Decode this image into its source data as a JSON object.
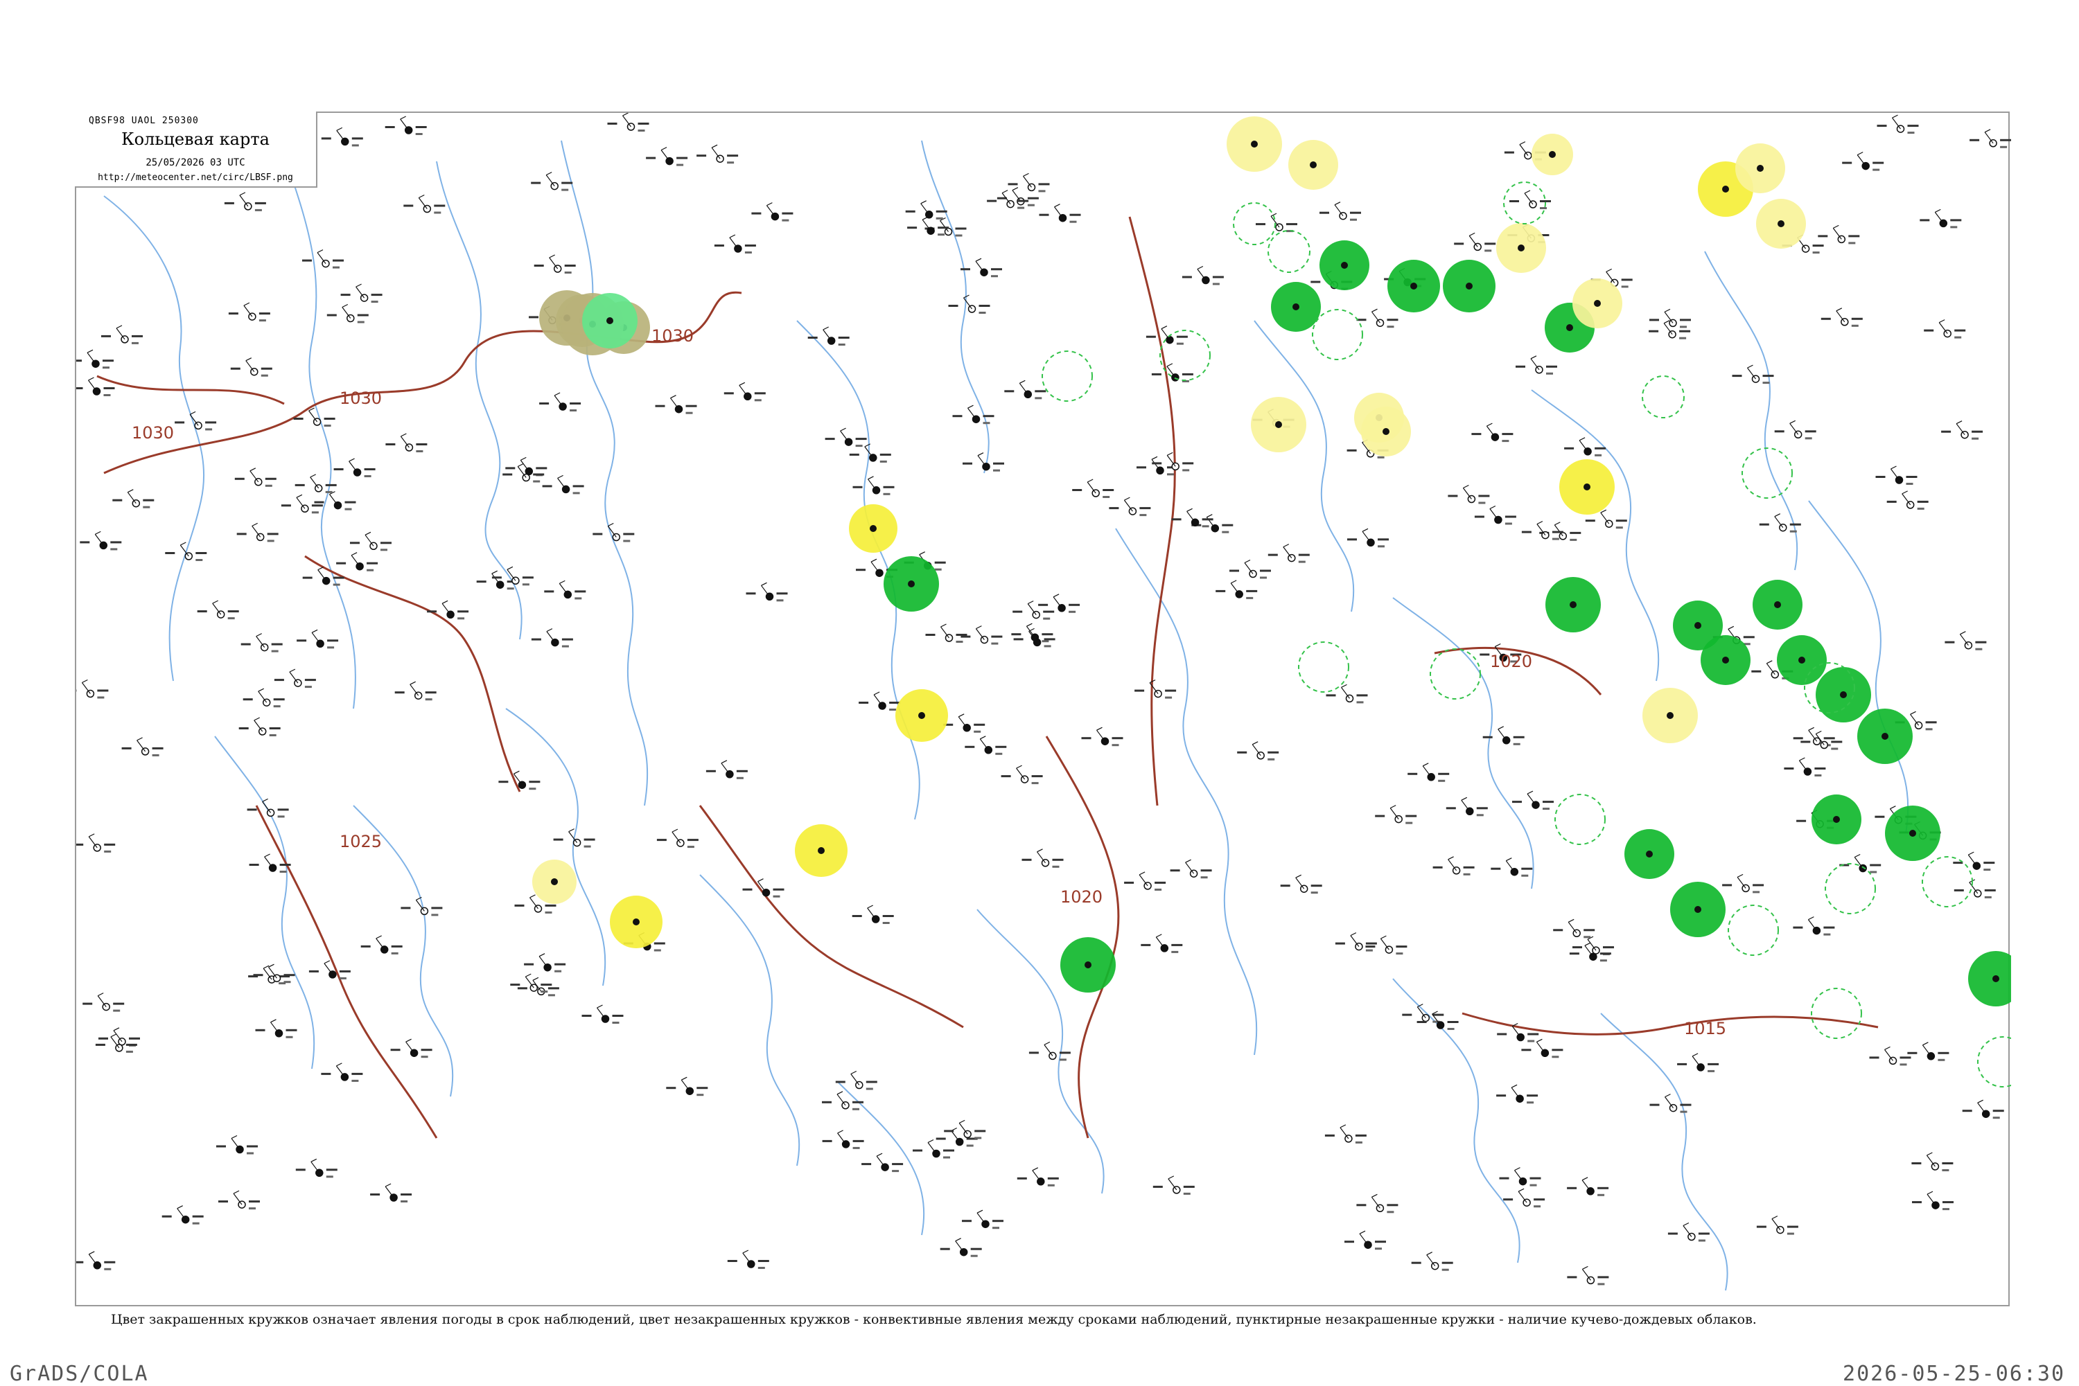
{
  "header": {
    "code": "QBSF98  UAOL  250300",
    "title": "Кольцевая карта",
    "datetime": "25/05/2026 03 UTC",
    "url": "http://meteocenter.net/circ/LBSF.png"
  },
  "isobars": [
    {
      "label": "1030"
    },
    {
      "label": "1030"
    },
    {
      "label": "1030"
    },
    {
      "label": "1025"
    },
    {
      "label": "1020"
    },
    {
      "label": "1015"
    },
    {
      "label": "1020"
    }
  ],
  "colors": {
    "isobar": "#9a3b2a",
    "river": "#7fb2e6",
    "dashed_circle": "#34c24a",
    "yellow_fill": "#f5ef3a",
    "yellow_light": "#f8f39a",
    "green_fill": "#11b82e",
    "light_green": "#63e58b",
    "olive_fill": "#b9b27a",
    "frame": "#9a9a9a"
  },
  "legend_note": "Цвет закрашенных кружков означает явления погоды в срок наблюдений, цвет незакрашенных кружков - конвективные явления между сроками наблюдений, пунктирные незакрашенные кружки - наличие кучево-дождевых облаков.",
  "footer": {
    "left": "GrADS/COLA",
    "right": "2026-05-25-06:30"
  }
}
